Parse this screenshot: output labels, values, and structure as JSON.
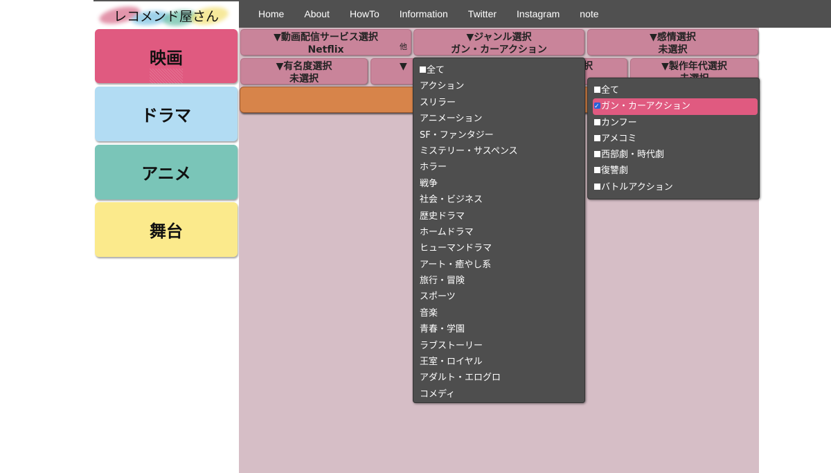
{
  "site": {
    "logo_text": "レコメンド屋さん"
  },
  "nav": {
    "items": [
      {
        "label": "Home"
      },
      {
        "label": "About"
      },
      {
        "label": "HowTo"
      },
      {
        "label": "Information"
      },
      {
        "label": "Twitter"
      },
      {
        "label": "Instagram"
      },
      {
        "label": "note"
      }
    ]
  },
  "sidebar": {
    "items": [
      {
        "label": "映画",
        "color": "#e05a80",
        "active": true
      },
      {
        "label": "ドラマ",
        "color": "#b2dcf3"
      },
      {
        "label": "アニメ",
        "color": "#7ac5b8"
      },
      {
        "label": "舞台",
        "color": "#fbea8c"
      }
    ]
  },
  "filters": {
    "service": {
      "title": "▼動画配信サービス選択",
      "value": "Netflix",
      "hint": "他"
    },
    "genre": {
      "title": "▼ジャンル選択",
      "value": "ガン・カーアクション"
    },
    "emotion": {
      "title": "▼感情選択",
      "value": "未選択"
    },
    "fame": {
      "title": "▼有名度選択",
      "value": "未選択"
    },
    "middle": {
      "title_visible_prefix": "▼",
      "title_visible_suffix": "択"
    },
    "year": {
      "title": "▼製作年代選択",
      "value": "未選択"
    }
  },
  "genre_dropdown": {
    "all_label": "全て",
    "items": [
      "アクション",
      "スリラー",
      "アニメーション",
      "SF・ファンタジー",
      "ミステリー・サスペンス",
      "ホラー",
      "戦争",
      "社会・ビジネス",
      "歴史ドラマ",
      "ホームドラマ",
      "ヒューマンドラマ",
      "アート・癒やし系",
      "旅行・冒険",
      "スポーツ",
      "音楽",
      "青春・学園",
      "ラブストーリー",
      "王室・ロイヤル",
      "アダルト・エログロ",
      "コメディ"
    ]
  },
  "subgenre_dropdown": {
    "items": [
      {
        "label": "全て",
        "checked": false
      },
      {
        "label": "ガン・カーアクション",
        "checked": true
      },
      {
        "label": "カンフー",
        "checked": false
      },
      {
        "label": "アメコミ",
        "checked": false
      },
      {
        "label": "西部劇・時代劇",
        "checked": false
      },
      {
        "label": "復讐劇",
        "checked": false
      },
      {
        "label": "バトルアクション",
        "checked": false
      }
    ]
  },
  "colors": {
    "nav_bg": "#505050",
    "filter_bg": "#c9849a",
    "search_bar": "#d7844a",
    "content_bg": "#d6bec6",
    "selected": "#e05a80"
  }
}
